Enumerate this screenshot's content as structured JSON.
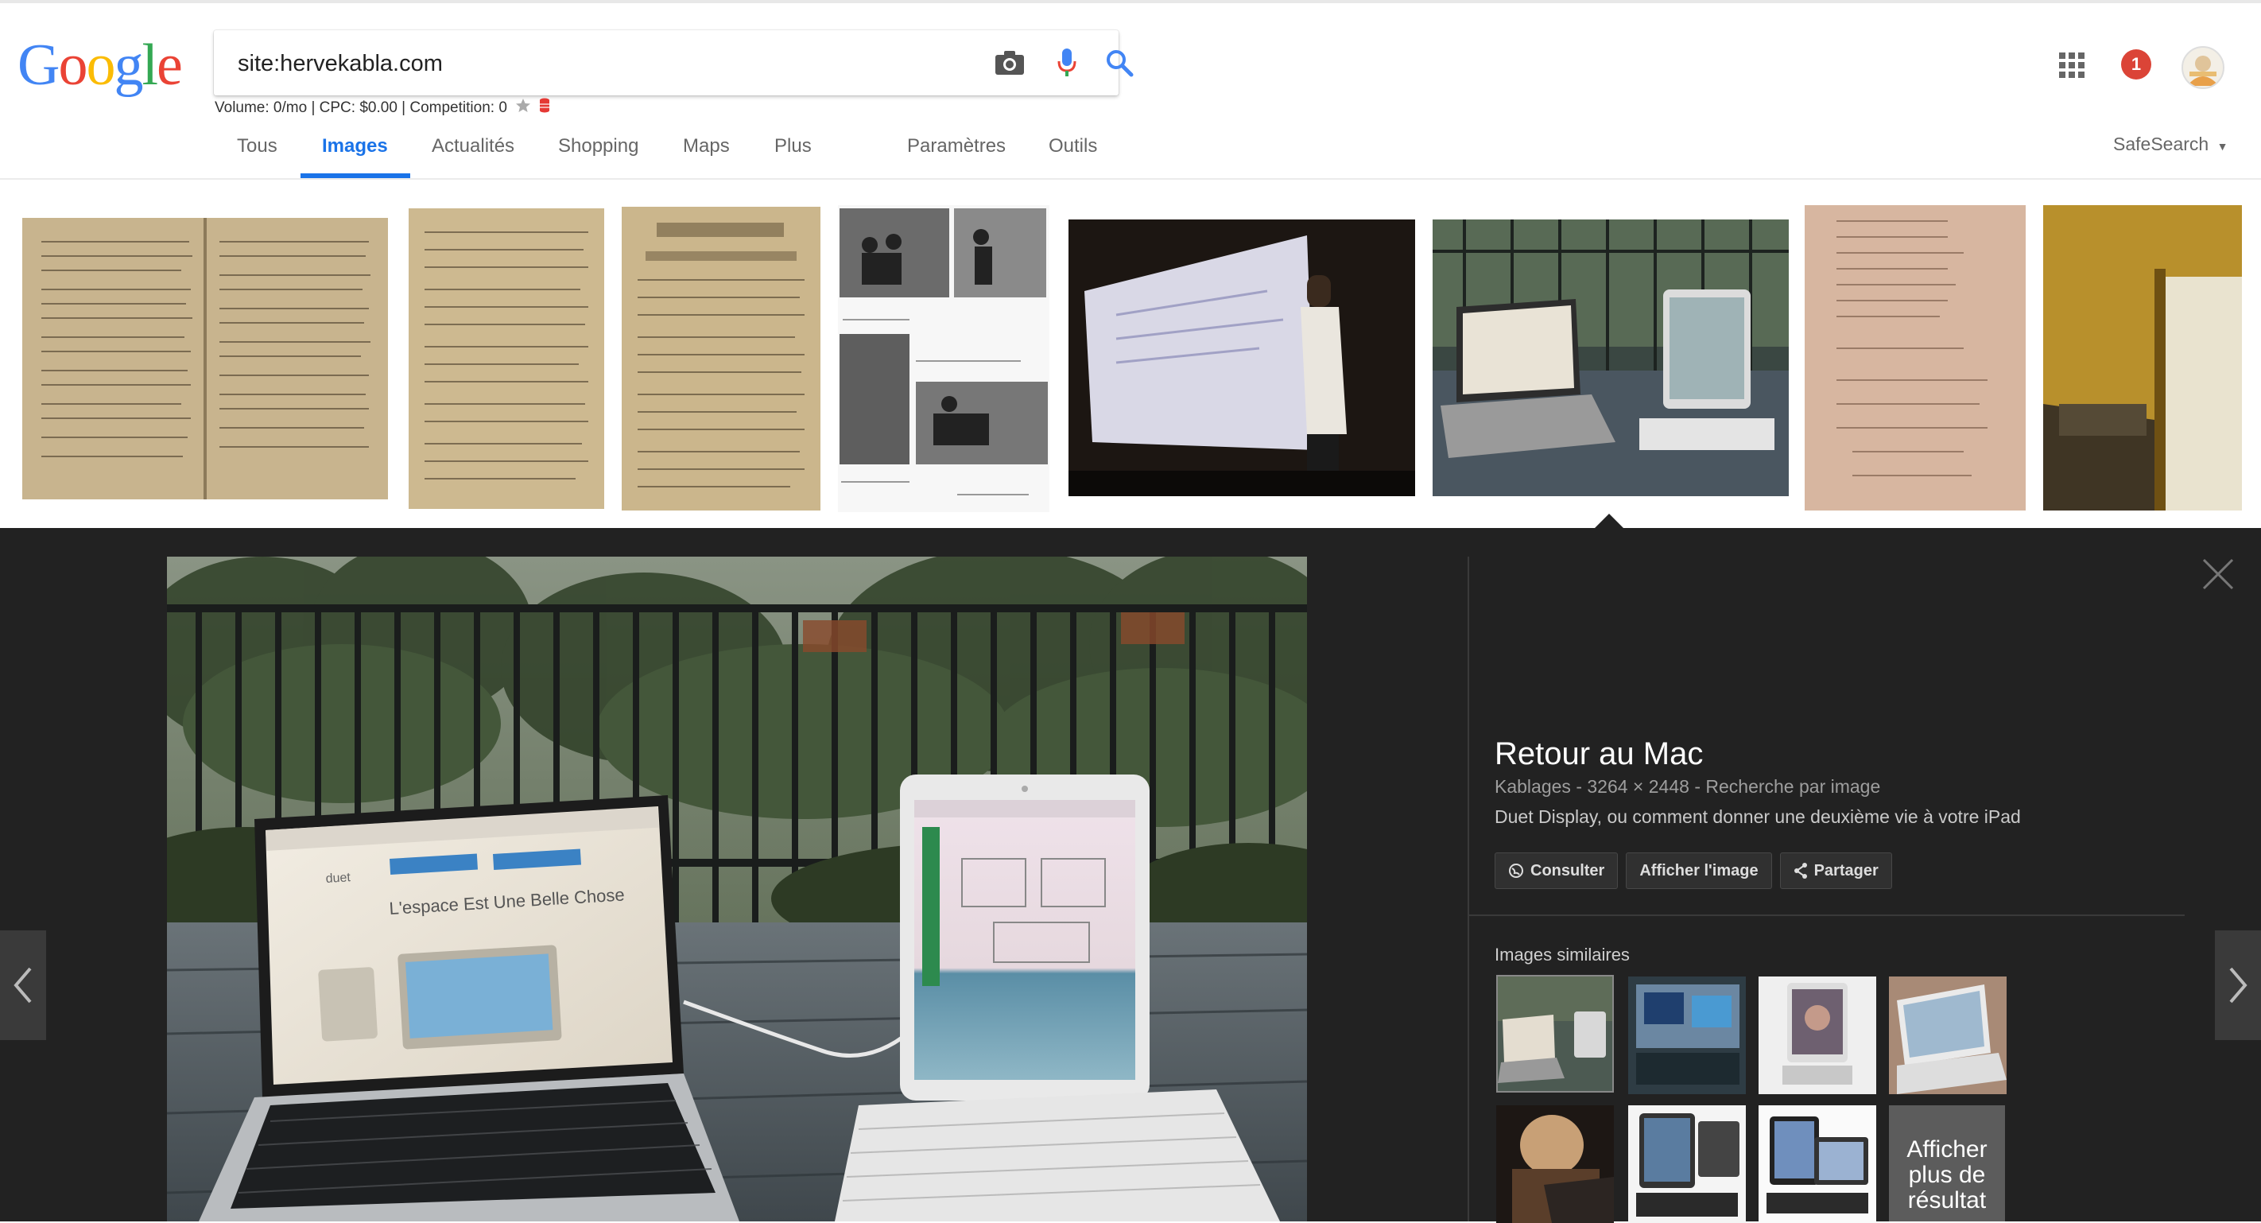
{
  "header": {
    "logo_letters": [
      "G",
      "o",
      "o",
      "g",
      "l",
      "e"
    ],
    "logo_colors": [
      "#4285f4",
      "#ea4335",
      "#fbbc05",
      "#4285f4",
      "#34a853",
      "#ea4335"
    ],
    "search_value": "site:hervekabla.com",
    "seo_text": "Volume: 0/mo | CPC: $0.00 | Competition: 0",
    "notification_count": "1"
  },
  "tabs": [
    {
      "label": "Tous"
    },
    {
      "label": "Images",
      "active": true
    },
    {
      "label": "Actualités"
    },
    {
      "label": "Shopping"
    },
    {
      "label": "Maps"
    },
    {
      "label": "Plus"
    },
    {
      "label": "Paramètres"
    },
    {
      "label": "Outils"
    }
  ],
  "safesearch": "SafeSearch",
  "viewer": {
    "title": "Retour au Mac",
    "source": "Kablages",
    "dimensions": "3264 × 2448",
    "search_by_image": "Recherche par image",
    "description": "Duet Display, ou comment donner une deuxième vie à votre iPad",
    "buttons": {
      "visit": "Consulter",
      "view_image": "Afficher l'image",
      "share": "Partager"
    },
    "similar_label": "Images similaires",
    "more_label": [
      "Afficher",
      "plus de",
      "résultat"
    ],
    "laptop_screen_text": "L'espace Est Une Belle Chose",
    "laptop_brand": "duet"
  },
  "colors": {
    "accent": "#1a73e8",
    "viewer_bg": "#222222",
    "badge": "#db4437"
  },
  "icons": {
    "camera": "camera-icon",
    "mic": "microphone-icon",
    "search": "search-icon",
    "apps": "apps-grid-icon",
    "close": "close-icon"
  }
}
